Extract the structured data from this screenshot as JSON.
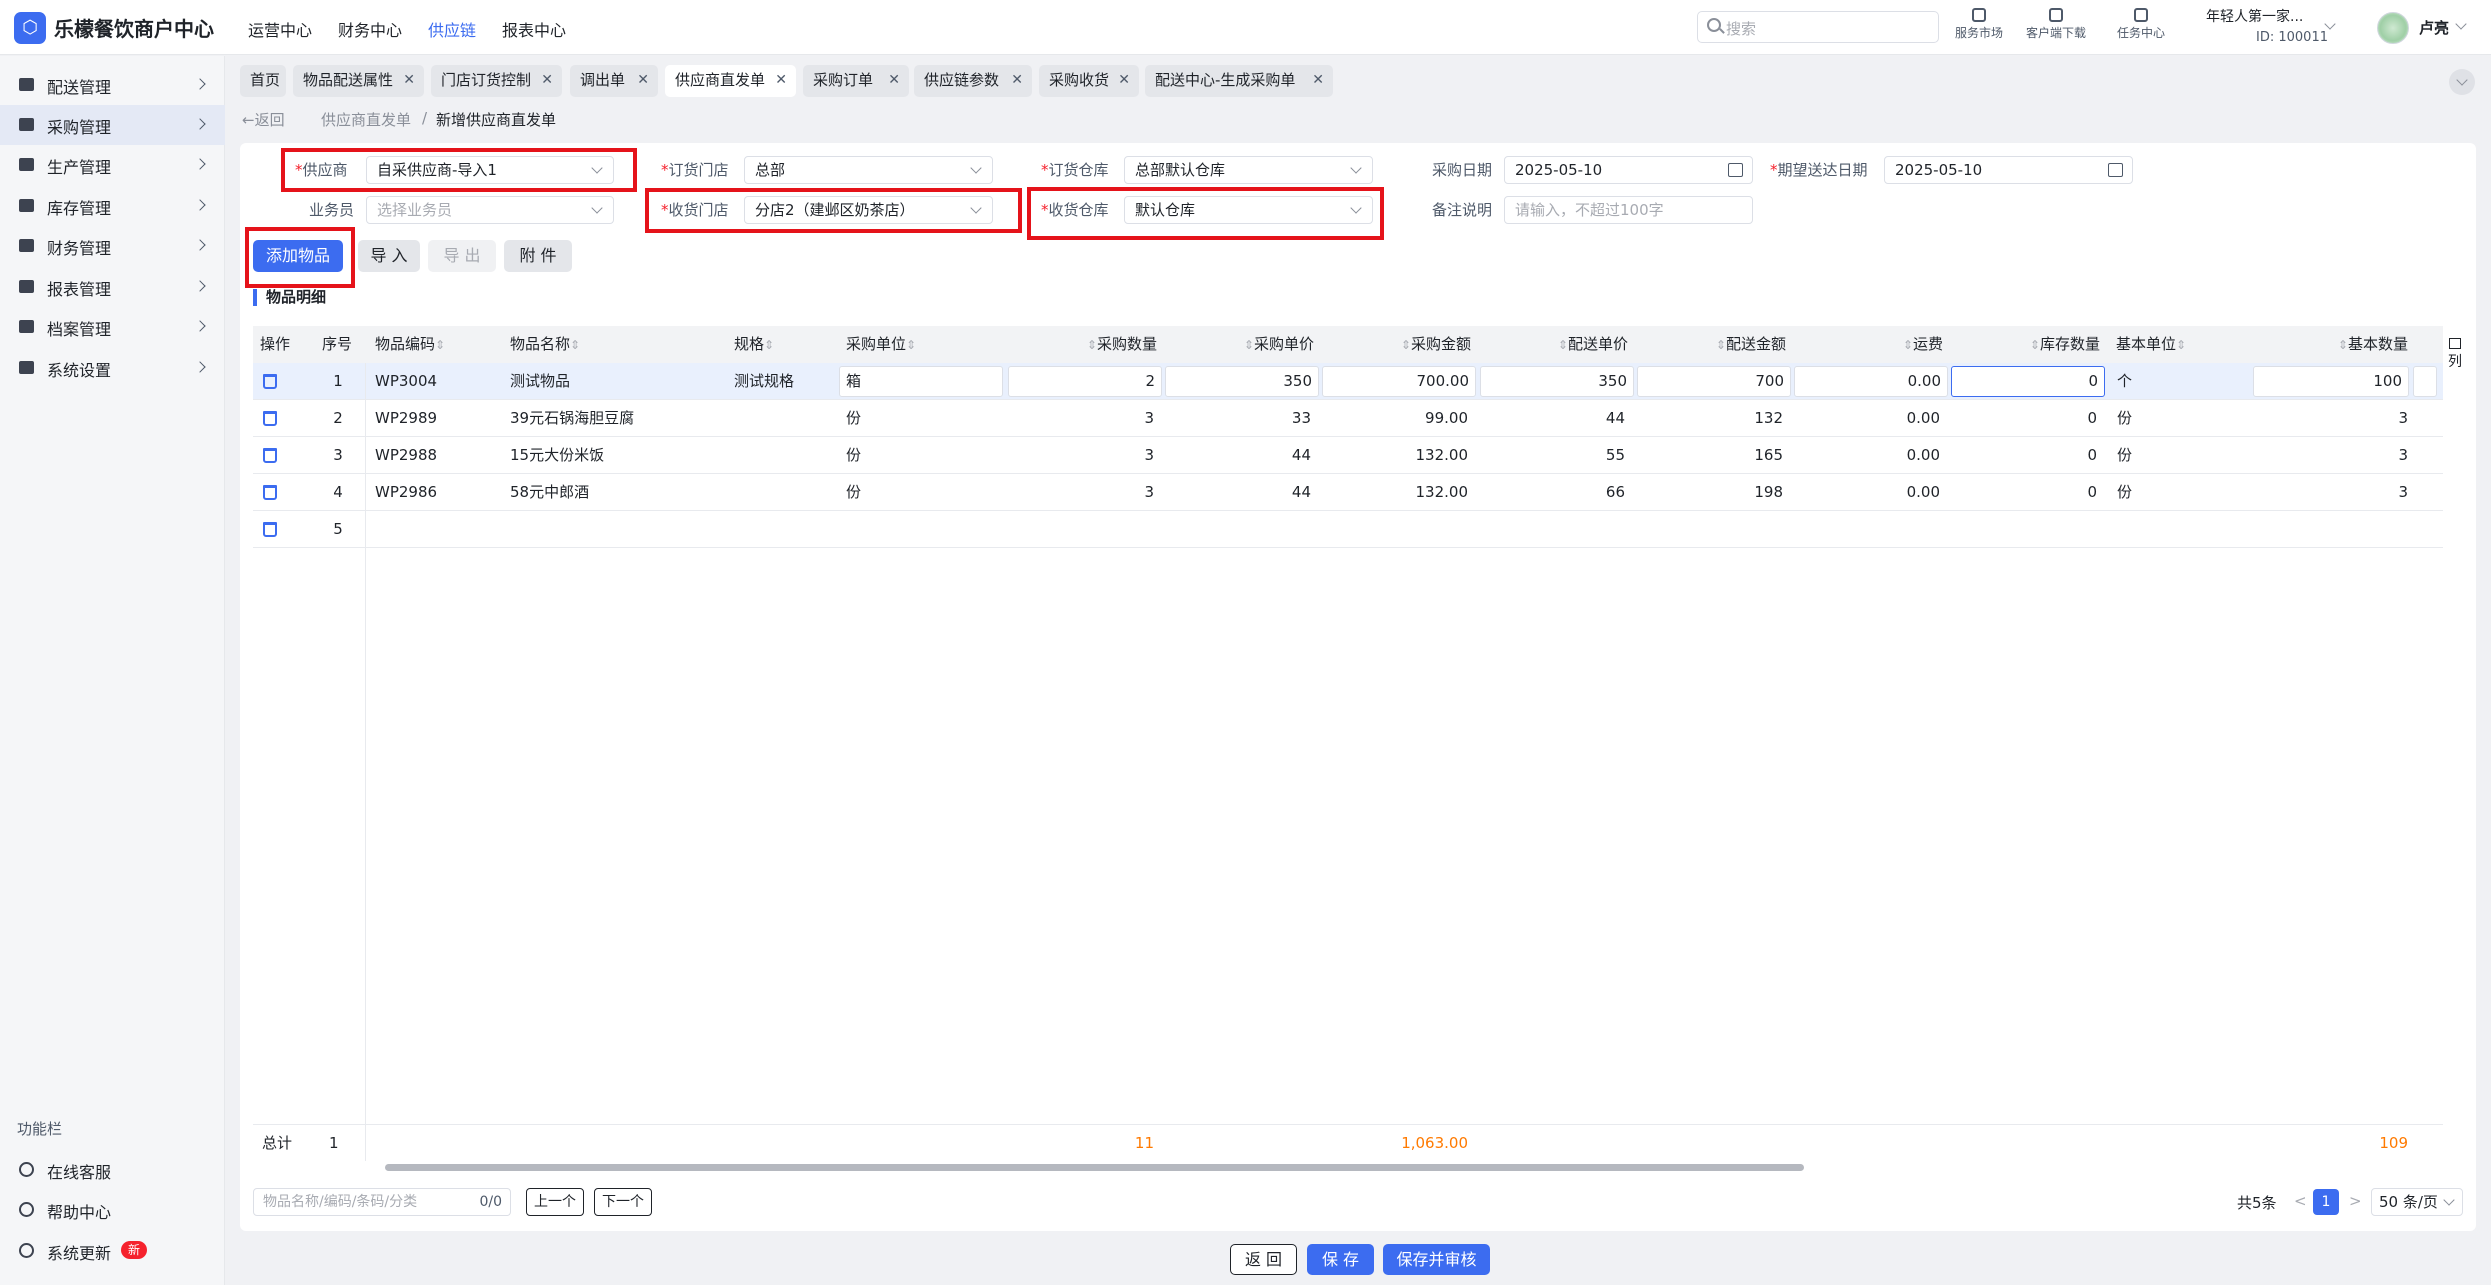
{
  "app": {
    "title": "乐檬餐饮商户中心",
    "logo_glyph": "⬡"
  },
  "top_nav": [
    "运营中心",
    "财务中心",
    "供应链",
    "报表中心"
  ],
  "top_nav_active": "供应链",
  "search": {
    "placeholder": "搜索"
  },
  "tools": [
    {
      "label": "服务市场",
      "icon": "shop-icon"
    },
    {
      "label": "客户端下载",
      "icon": "folder-download-icon"
    },
    {
      "label": "任务中心",
      "icon": "clipboard-icon"
    }
  ],
  "org": {
    "name": "年轻人第一家...",
    "id": "ID: 100011"
  },
  "user": {
    "name": "卢亮"
  },
  "sidebar": {
    "items": [
      {
        "label": "配送管理",
        "icon": "truck-icon"
      },
      {
        "label": "采购管理",
        "icon": "inbox-icon"
      },
      {
        "label": "生产管理",
        "icon": "bar-chart-icon"
      },
      {
        "label": "库存管理",
        "icon": "warehouse-icon"
      },
      {
        "label": "财务管理",
        "icon": "wallet-icon"
      },
      {
        "label": "报表管理",
        "icon": "store-icon"
      },
      {
        "label": "档案管理",
        "icon": "archive-icon"
      },
      {
        "label": "系统设置",
        "icon": "gear-icon"
      }
    ],
    "active": "采购管理",
    "func_title": "功能栏",
    "func_items": [
      {
        "label": "在线客服",
        "icon": "headset-icon"
      },
      {
        "label": "帮助中心",
        "icon": "help-icon"
      },
      {
        "label": "系统更新",
        "icon": "refresh-icon",
        "badge": "新"
      }
    ]
  },
  "tabs": [
    {
      "label": "首页",
      "closable": false
    },
    {
      "label": "物品配送属性",
      "closable": true
    },
    {
      "label": "门店订货控制",
      "closable": true
    },
    {
      "label": "调出单",
      "closable": true
    },
    {
      "label": "供应商直发单",
      "closable": true,
      "active": true
    },
    {
      "label": "采购订单",
      "closable": true
    },
    {
      "label": "供应链参数",
      "closable": true
    },
    {
      "label": "采购收货",
      "closable": true
    },
    {
      "label": "配送中心-生成采购单",
      "closable": true
    }
  ],
  "breadcrumb": {
    "back": "←返回",
    "parent": "供应商直发单",
    "sep": "/",
    "current": "新增供应商直发单"
  },
  "form": {
    "supplier": {
      "label": "供应商",
      "value": "自采供应商-导入1"
    },
    "order_store": {
      "label": "订货门店",
      "value": "总部"
    },
    "order_warehouse": {
      "label": "订货仓库",
      "value": "总部默认仓库"
    },
    "purchase_date": {
      "label": "采购日期",
      "value": "2025-05-10"
    },
    "expected_date": {
      "label": "期望送达日期",
      "value": "2025-05-10"
    },
    "salesperson": {
      "label": "业务员",
      "placeholder": "选择业务员"
    },
    "receive_store": {
      "label": "收货门店",
      "value": "分店2（建邺区奶茶店）"
    },
    "receive_warehouse": {
      "label": "收货仓库",
      "value": "默认仓库"
    },
    "remark": {
      "label": "备注说明",
      "placeholder": "请输入，不超过100字"
    }
  },
  "actions": {
    "add": "添加物品",
    "import": "导 入",
    "export": "导 出",
    "attach": "附 件"
  },
  "section_title": "物品明细",
  "table": {
    "headers": [
      "操作",
      "序号",
      "物品编码",
      "物品名称",
      "规格",
      "采购单位",
      "采购数量",
      "采购单价",
      "采购金额",
      "配送单价",
      "配送金额",
      "运费",
      "库存数量",
      "基本单位",
      "基本数量"
    ],
    "rows": [
      {
        "seq": "1",
        "code": "WP3004",
        "name": "测试物品",
        "spec": "测试规格",
        "unit": "箱",
        "qty": "2",
        "price": "350",
        "amount": "700.00",
        "dprice": "350",
        "damount": "700",
        "freight": "0.00",
        "stock": "0",
        "base_unit": "个",
        "base_qty": "100"
      },
      {
        "seq": "2",
        "code": "WP2989",
        "name": "39元石锅海胆豆腐",
        "spec": "",
        "unit": "份",
        "qty": "3",
        "price": "33",
        "amount": "99.00",
        "dprice": "44",
        "damount": "132",
        "freight": "0.00",
        "stock": "0",
        "base_unit": "份",
        "base_qty": "3"
      },
      {
        "seq": "3",
        "code": "WP2988",
        "name": "15元大份米饭",
        "spec": "",
        "unit": "份",
        "qty": "3",
        "price": "44",
        "amount": "132.00",
        "dprice": "55",
        "damount": "165",
        "freight": "0.00",
        "stock": "0",
        "base_unit": "份",
        "base_qty": "3"
      },
      {
        "seq": "4",
        "code": "WP2986",
        "name": "58元中郎酒",
        "spec": "",
        "unit": "份",
        "qty": "3",
        "price": "44",
        "amount": "132.00",
        "dprice": "66",
        "damount": "198",
        "freight": "0.00",
        "stock": "0",
        "base_unit": "份",
        "base_qty": "3"
      },
      {
        "seq": "5"
      }
    ],
    "column_setting": "列",
    "footer": {
      "label": "总计",
      "count": "1",
      "qty": "11",
      "amount": "1,063.00",
      "base_qty": "109"
    }
  },
  "finder": {
    "placeholder": "物品名称/编码/条码/分类",
    "count": "0/0",
    "prev": "上一个",
    "next": "下一个"
  },
  "pagination": {
    "total": "共5条",
    "prev": "<",
    "page": "1",
    "next": ">",
    "size": "50 条/页"
  },
  "footer_buttons": {
    "back": "返 回",
    "save": "保 存",
    "save_audit": "保存并审核"
  },
  "colors": {
    "accent": "#3c6cf0",
    "highlight": "#e5131a",
    "total": "#ff7a00"
  }
}
